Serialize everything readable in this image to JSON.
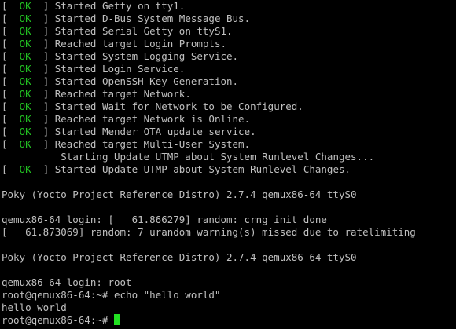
{
  "terminal": {
    "status_lines": [
      {
        "ok": "OK",
        "message": "Started Getty on tty1."
      },
      {
        "ok": "OK",
        "message": "Started D-Bus System Message Bus."
      },
      {
        "ok": "OK",
        "message": "Started Serial Getty on ttyS1."
      },
      {
        "ok": "OK",
        "message": "Reached target Login Prompts."
      },
      {
        "ok": "OK",
        "message": "Started System Logging Service."
      },
      {
        "ok": "OK",
        "message": "Started Login Service."
      },
      {
        "ok": "OK",
        "message": "Started OpenSSH Key Generation."
      },
      {
        "ok": "OK",
        "message": "Reached target Network."
      },
      {
        "ok": "OK",
        "message": "Started Wait for Network to be Configured."
      },
      {
        "ok": "OK",
        "message": "Reached target Network is Online."
      },
      {
        "ok": "OK",
        "message": "Started Mender OTA update service."
      },
      {
        "ok": "OK",
        "message": "Reached target Multi-User System."
      }
    ],
    "starting_line": "Starting Update UTMP about System Runlevel Changes...",
    "final_status": {
      "ok": "OK",
      "message": "Started Update UTMP about System Runlevel Changes."
    },
    "banner_1": "Poky (Yocto Project Reference Distro) 2.7.4 qemux86-64 ttyS0",
    "login_random_1": "qemux86-64 login: [   61.866279] random: crng init done",
    "login_random_2": "[   61.873069] random: 7 urandom warning(s) missed due to ratelimiting",
    "banner_2": "Poky (Yocto Project Reference Distro) 2.7.4 qemux86-64 ttyS0",
    "login_root": "qemux86-64 login: root",
    "command_line": "root@qemux86-64:~# echo \"hello world\"",
    "output": "hello world",
    "prompt": "root@qemux86-64:~# "
  },
  "colors": {
    "background": "#000000",
    "text": "#c0c0c0",
    "ok": "#22c022",
    "cursor": "#22e022"
  }
}
